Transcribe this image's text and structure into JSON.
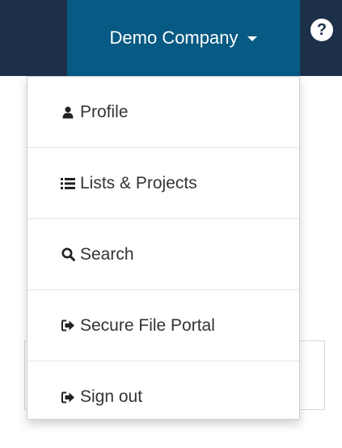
{
  "navbar": {
    "company_label": "Demo Company",
    "help_label": "?"
  },
  "dropdown": {
    "items": [
      {
        "label": "Profile",
        "icon": "user-icon"
      },
      {
        "label": "Lists & Projects",
        "icon": "list-icon"
      },
      {
        "label": "Search",
        "icon": "search-icon"
      },
      {
        "label": "Secure File Portal",
        "icon": "share-arrow-icon"
      },
      {
        "label": "Sign out",
        "icon": "sign-out-icon"
      }
    ]
  },
  "colors": {
    "navbar_dark": "#1c3049",
    "navbar_active": "#075a83",
    "menu_text": "#333333"
  }
}
